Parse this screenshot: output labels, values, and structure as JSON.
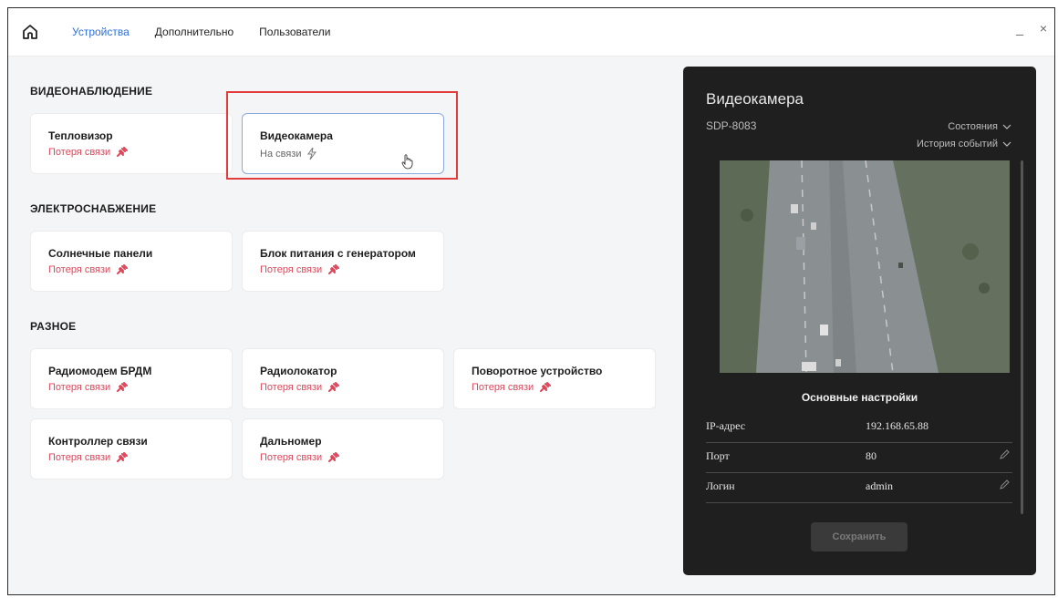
{
  "topbar": {
    "tabs": [
      {
        "label": "Устройства"
      },
      {
        "label": "Дополнительно"
      },
      {
        "label": "Пользователи"
      }
    ],
    "minimize": "_",
    "close": "×"
  },
  "sections": [
    {
      "title": "ВИДЕОНАБЛЮДЕНИЕ"
    },
    {
      "title": "ЭЛЕКТРОСНАБЖЕНИЕ"
    },
    {
      "title": "РАЗНОЕ"
    }
  ],
  "devices": [
    {
      "name": "Тепловизор",
      "status": "Потеря связи"
    },
    {
      "name": "Видеокамера",
      "status": "На связи"
    },
    {
      "name": "Солнечные панели",
      "status": "Потеря связи"
    },
    {
      "name": "Блок питания с генератором",
      "status": "Потеря связи"
    },
    {
      "name": "Радиомодем БРДМ",
      "status": "Потеря связи"
    },
    {
      "name": "Радиолокатор",
      "status": "Потеря связи"
    },
    {
      "name": "Поворотное устройство",
      "status": "Потеря связи"
    },
    {
      "name": "Контроллер связи",
      "status": "Потеря связи"
    },
    {
      "name": "Дальномер",
      "status": "Потеря связи"
    }
  ],
  "panel": {
    "title": "Видеокамера",
    "model": "SDP-8083",
    "states_label": "Состояния",
    "history_label": "История событий",
    "settings_title": "Основные настройки",
    "rows": [
      {
        "key": "IP-адрес",
        "value": "192.168.65.88"
      },
      {
        "key": "Порт",
        "value": "80"
      },
      {
        "key": "Логин",
        "value": "admin"
      }
    ],
    "save_label": "Сохранить"
  },
  "colors": {
    "accent": "#2f6fd6",
    "lost": "#e0465a",
    "highlight": "#e23b3b",
    "panel_bg": "#1f1f1f"
  }
}
